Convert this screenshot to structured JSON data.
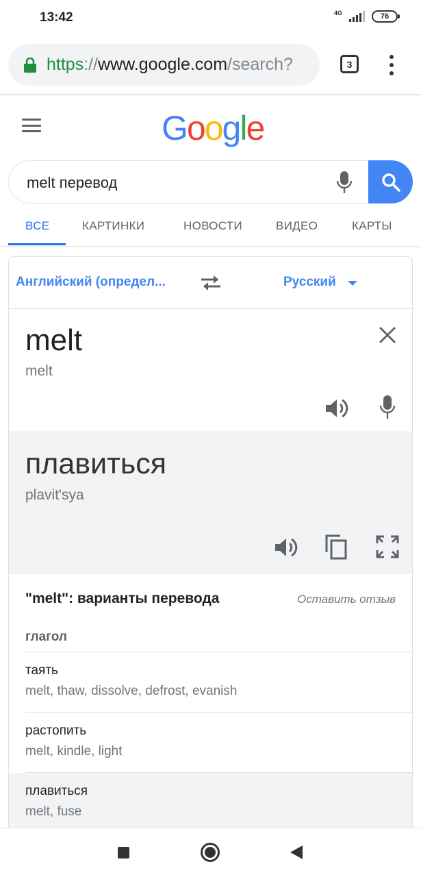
{
  "status_bar": {
    "time": "13:42",
    "network": "4G",
    "battery": "76"
  },
  "browser": {
    "url_scheme": "https",
    "url_separator": "://",
    "url_host": "www.google.com",
    "url_path": "/search?",
    "tab_count": "3",
    "secure_color": "#1e8e3e"
  },
  "google": {
    "logo_letters": [
      {
        "ch": "G",
        "color": "#4285f4"
      },
      {
        "ch": "o",
        "color": "#ea4335"
      },
      {
        "ch": "o",
        "color": "#fbbc05"
      },
      {
        "ch": "g",
        "color": "#4285f4"
      },
      {
        "ch": "l",
        "color": "#34a853"
      },
      {
        "ch": "e",
        "color": "#ea4335"
      }
    ],
    "query": "melt перевод",
    "accent": "#4285f4"
  },
  "tabs": [
    {
      "label": "ВСЕ",
      "active": true
    },
    {
      "label": "КАРТИНКИ",
      "active": false
    },
    {
      "label": "НОВОСТИ",
      "active": false
    },
    {
      "label": "ВИДЕО",
      "active": false
    },
    {
      "label": "КАРТЫ",
      "active": false
    }
  ],
  "translate": {
    "source_language": "Английский (определ...",
    "target_language": "Русский",
    "source_word": "melt",
    "source_transliteration": "melt",
    "target_word": "плавиться",
    "target_transliteration": "plavit'sya",
    "variants_header": "\"melt\": варианты перевода",
    "feedback_link": "Оставить отзыв",
    "part_of_speech": "глагол",
    "variants": [
      {
        "word": "таять",
        "synonyms": "melt, thaw, dissolve, defrost, evanish",
        "highlighted": false
      },
      {
        "word": "растопить",
        "synonyms": "melt, kindle, light",
        "highlighted": false
      },
      {
        "word": "плавиться",
        "synonyms": "melt, fuse",
        "highlighted": true
      }
    ]
  },
  "icons": {
    "lock": "lock-icon",
    "menu": "more-vert-icon",
    "hamburger": "hamburger-menu-icon",
    "mic": "microphone-icon",
    "search": "search-icon",
    "swap": "swap-languages-icon",
    "close": "close-icon",
    "speaker": "speaker-icon",
    "copy": "copy-icon",
    "fullscreen": "fullscreen-icon"
  }
}
